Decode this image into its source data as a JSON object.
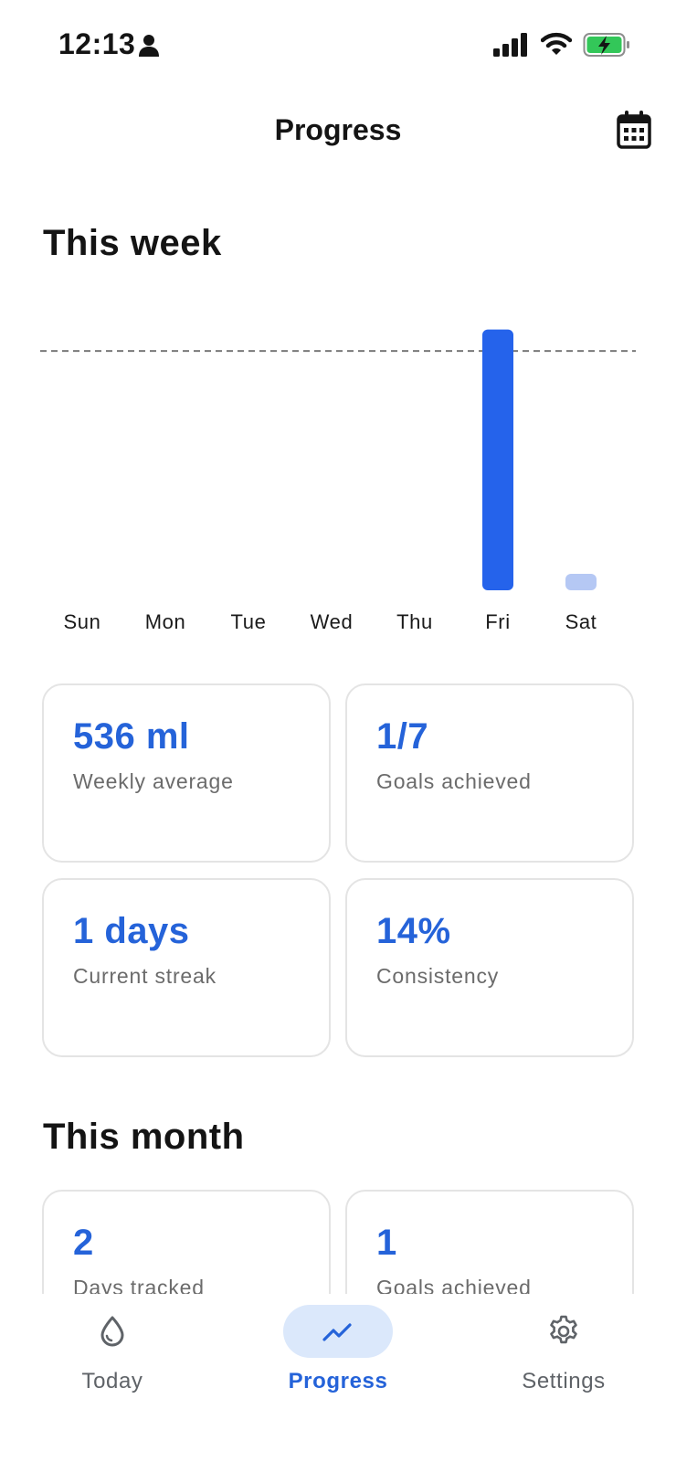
{
  "status_bar": {
    "time": "12:13",
    "icons": [
      "person-icon",
      "signal-icon",
      "wifi-icon",
      "battery-charging-icon"
    ]
  },
  "header": {
    "title": "Progress",
    "calendar_icon": "calendar-icon"
  },
  "week": {
    "title": "This week"
  },
  "chart_data": {
    "type": "bar",
    "categories": [
      "Sun",
      "Mon",
      "Tue",
      "Wed",
      "Thu",
      "Fri",
      "Sat"
    ],
    "values": [
      0,
      0,
      0,
      0,
      0,
      1.09,
      0.06
    ],
    "goal_line": 1.0,
    "ylim": [
      0,
      1.1
    ],
    "grid": false,
    "colors": {
      "bar": "#2563eb",
      "bar_partial": "#b5c8f4",
      "goal_line": "#7a7a7a"
    }
  },
  "week_stats": [
    {
      "value": "536 ml",
      "label": "Weekly average"
    },
    {
      "value": "1/7",
      "label": "Goals achieved"
    },
    {
      "value": "1 days",
      "label": "Current streak"
    },
    {
      "value": "14%",
      "label": "Consistency"
    }
  ],
  "month": {
    "title": "This month",
    "stats": [
      {
        "value": "2",
        "label": "Days tracked"
      },
      {
        "value": "1",
        "label": "Goals achieved"
      }
    ]
  },
  "nav": {
    "active": "progress",
    "items": [
      {
        "id": "today",
        "label": "Today",
        "icon": "water-drop-icon"
      },
      {
        "id": "progress",
        "label": "Progress",
        "icon": "trend-line-icon"
      },
      {
        "id": "settings",
        "label": "Settings",
        "icon": "gear-icon"
      }
    ]
  },
  "colors": {
    "accent": "#2563d9",
    "active_nav_bg": "#dbe8fb",
    "muted_text": "#6b6b6b"
  }
}
